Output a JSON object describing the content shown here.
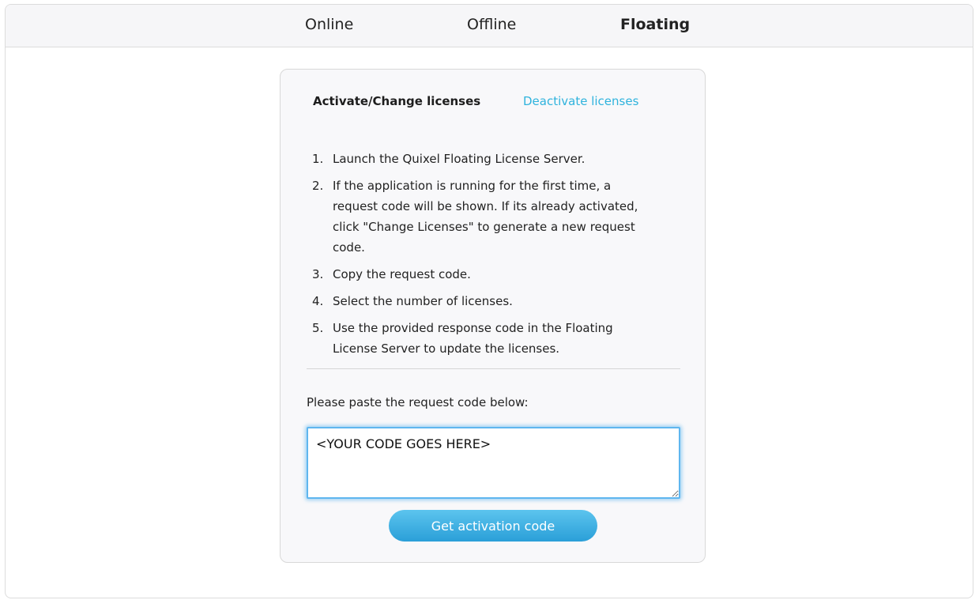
{
  "top_tabs": [
    {
      "label": "Online",
      "active": false
    },
    {
      "label": "Offline",
      "active": false
    },
    {
      "label": "Floating",
      "active": true
    }
  ],
  "card": {
    "sub_tabs": {
      "activate": "Activate/Change licenses",
      "deactivate": "Deactivate licenses"
    },
    "steps": [
      {
        "num": "1.",
        "text": "Launch the Quixel Floating License Server."
      },
      {
        "num": "2.",
        "text": "If the application is running for the first time, a request code will be shown. If its already activated, click \"Change Licenses\" to generate a new request code."
      },
      {
        "num": "3.",
        "text": "Copy the request code."
      },
      {
        "num": "4.",
        "text": "Select the number of licenses."
      },
      {
        "num": "5.",
        "text": "Use the provided response code in the Floating License Server to update the licenses."
      }
    ],
    "paste_label": "Please paste the request code below:",
    "code_value": "<YOUR CODE GOES HERE>",
    "button_label": "Get activation code"
  },
  "colors": {
    "link": "#2fb3dd",
    "button": "#3aaee0",
    "focus_ring": "#5fb6ef"
  }
}
